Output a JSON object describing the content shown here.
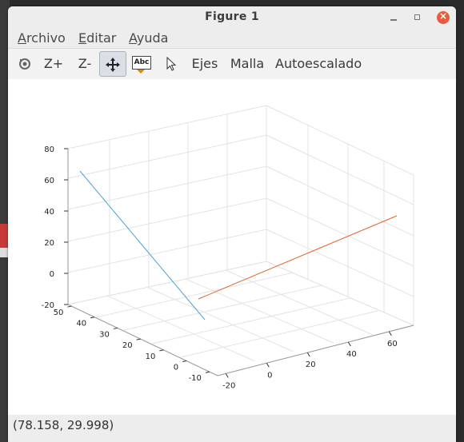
{
  "window": {
    "title": "Figure 1"
  },
  "menu": [
    {
      "key": "A",
      "rest": "rchivo"
    },
    {
      "key": "E",
      "rest": "ditar"
    },
    {
      "key": "A",
      "rest": "yuda"
    }
  ],
  "toolbar": {
    "zoom_in": "Z+",
    "zoom_out": "Z-",
    "text_icon": "Abc",
    "axes": "Ejes",
    "grid": "Malla",
    "autoscale": "Autoescalado"
  },
  "status": {
    "coords": "(78.158, 29.998)"
  },
  "colors": {
    "series1": "#4a9fd8",
    "series2": "#e0642f"
  },
  "chart_data": {
    "type": "line",
    "projection": "3d",
    "zlim": [
      -20,
      80
    ],
    "zticks": [
      "80",
      "60",
      "40",
      "20",
      "0",
      "-20"
    ],
    "yticks_left": [
      "50",
      "40",
      "30",
      "20",
      "10",
      "0",
      "-10"
    ],
    "xticks_front": [
      "-20",
      "0",
      "20",
      "40",
      "60"
    ],
    "grid": true,
    "series": [
      {
        "color": "#4a9fd8"
      },
      {
        "color": "#e0642f"
      }
    ]
  }
}
